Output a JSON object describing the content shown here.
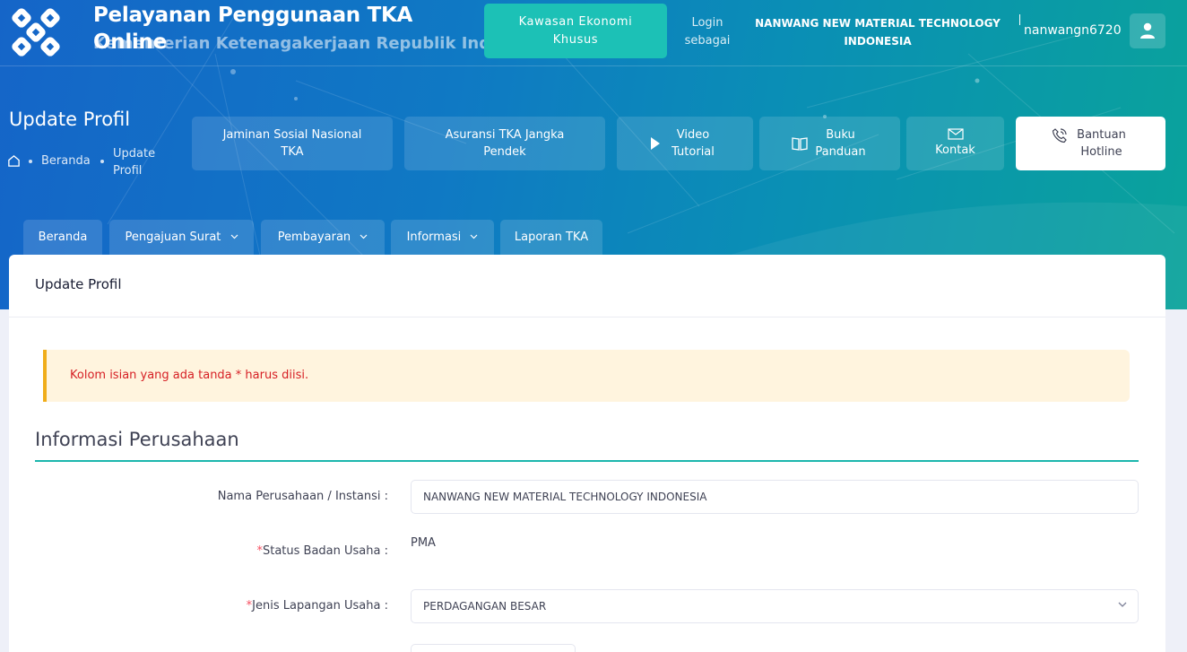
{
  "header": {
    "app_title_line1": "Pelayanan Penggunaan TKA",
    "app_title_line2_overlap": "Online",
    "app_subtitle": "Kementerian Ketenagakerjaan Republik Indonesia",
    "kek_button": "Kawasan Ekonomi Khusus",
    "login_as": "Login sebagai",
    "company": "NANWANG NEW MATERIAL TECHNOLOGY INDONESIA",
    "username": "nanwangn6720"
  },
  "page": {
    "title": "Update Profil",
    "breadcrumb": [
      "Beranda",
      "Update Profil"
    ]
  },
  "quick_links": [
    {
      "label": "Jaminan Sosial Nasional TKA",
      "icon": ""
    },
    {
      "label": "Asuransi TKA Jangka Pendek",
      "icon": ""
    },
    {
      "label": "Video Tutorial",
      "icon": "play-icon"
    },
    {
      "label": "Buku Panduan",
      "icon": "book-icon"
    },
    {
      "label": "Kontak",
      "icon": "mail-icon"
    },
    {
      "label": "Bantuan Hotline",
      "icon": "phone-icon"
    }
  ],
  "nav_tabs": [
    {
      "label": "Beranda",
      "dropdown": false
    },
    {
      "label": "Pengajuan Surat",
      "dropdown": true
    },
    {
      "label": "Pembayaran",
      "dropdown": true
    },
    {
      "label": "Informasi",
      "dropdown": true
    },
    {
      "label": "Laporan TKA",
      "dropdown": false
    }
  ],
  "card": {
    "title": "Update Profil",
    "alert": "Kolom isian yang ada tanda * harus diisi.",
    "section_title": "Informasi Perusahaan",
    "fields": {
      "company_name": {
        "label": "Nama Perusahaan / Instansi :",
        "value": "NANWANG NEW MATERIAL TECHNOLOGY INDONESIA"
      },
      "business_status": {
        "label": "Status Badan Usaha :",
        "value": "PMA"
      },
      "business_field": {
        "label": "Jenis Lapangan Usaha :",
        "value": "PERDAGANGAN BESAR"
      }
    },
    "required_mark": "*"
  },
  "colors": {
    "accent": "#1cc1b6",
    "banner_start": "#1565c8",
    "banner_end": "#0aa39b",
    "required": "#f64e60",
    "alert_text": "#d61f24"
  }
}
